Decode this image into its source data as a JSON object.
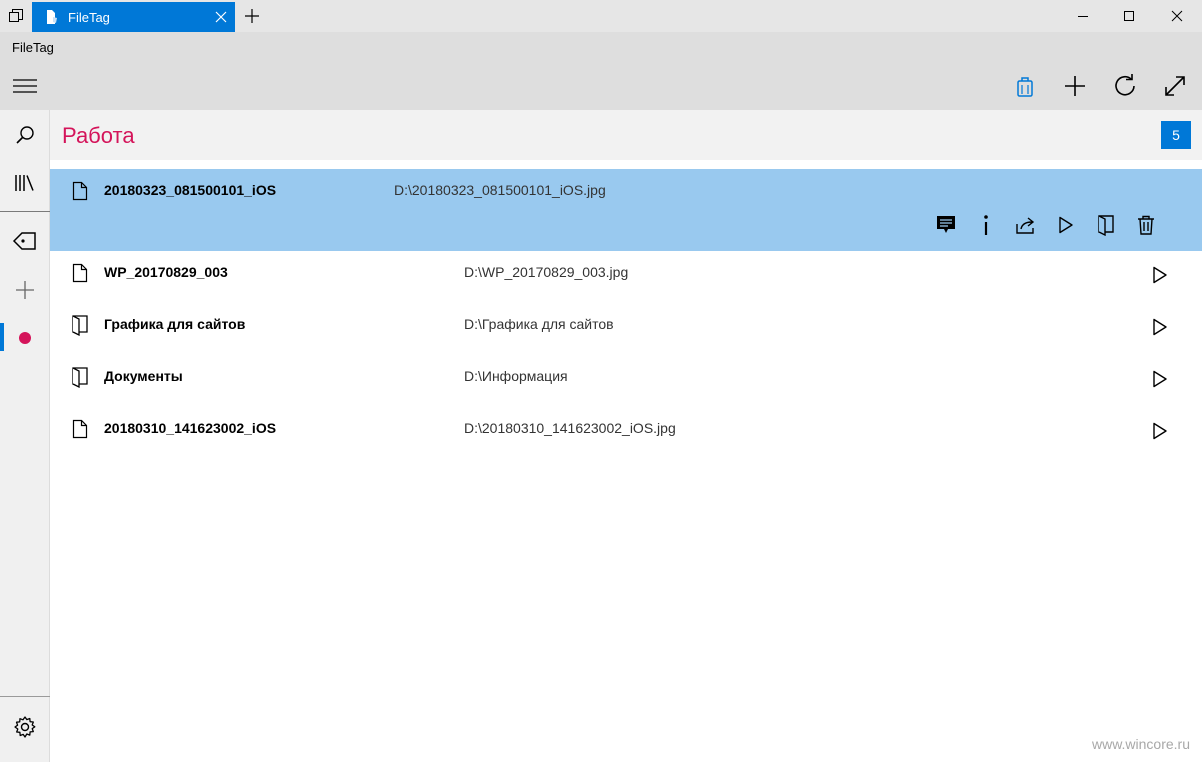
{
  "window": {
    "tab_title": "FileTag",
    "app_name": "FileTag",
    "controls": [
      "minimize",
      "maximize",
      "close"
    ]
  },
  "toolbar": {
    "icons": [
      "bag-icon",
      "add-icon",
      "refresh-icon",
      "expand-icon"
    ]
  },
  "rail": {
    "items": [
      "search",
      "library",
      "tags",
      "add-tag",
      "tag-red"
    ],
    "tag_color": "#d4145a",
    "settings": "settings"
  },
  "page": {
    "title": "Работа",
    "count": "5",
    "title_color": "#d4145a",
    "accent": "#0078d7"
  },
  "items": [
    {
      "type": "file",
      "name": "20180323_081500101_iOS",
      "path": "D:\\20180323_081500101_iOS.jpg",
      "selected": true
    },
    {
      "type": "file",
      "name": "WP_20170829_003",
      "path": "D:\\WP_20170829_003.jpg",
      "selected": false
    },
    {
      "type": "folder",
      "name": "Графика для сайтов",
      "path": "D:\\Графика для сайтов",
      "selected": false
    },
    {
      "type": "folder",
      "name": "Документы",
      "path": "D:\\Информация",
      "selected": false
    },
    {
      "type": "file",
      "name": "20180310_141623002_iOS",
      "path": "D:\\20180310_141623002_iOS.jpg",
      "selected": false
    }
  ],
  "selected_actions": [
    "comment",
    "info",
    "share",
    "open",
    "open-folder",
    "delete"
  ],
  "watermark": "www.wincore.ru"
}
